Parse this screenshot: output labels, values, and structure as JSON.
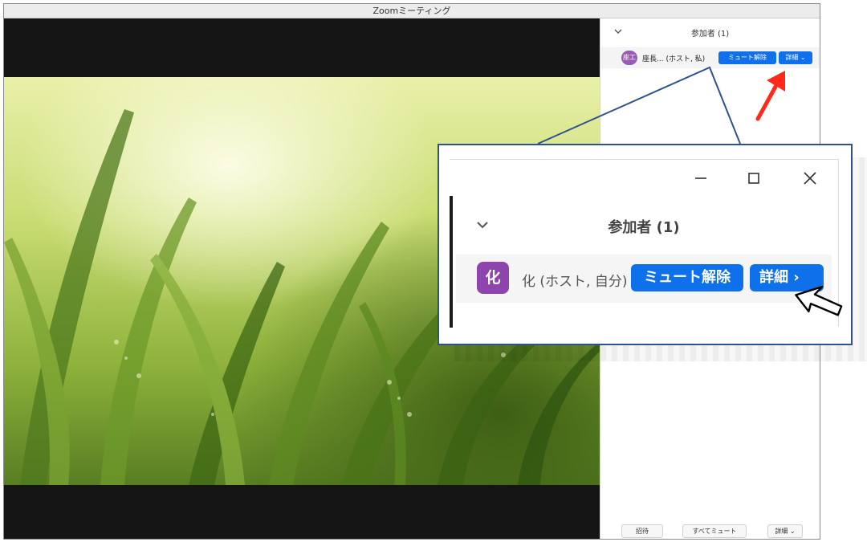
{
  "window": {
    "title": "Zoomミーティング"
  },
  "panel": {
    "title": "参加者 (1)",
    "participant": {
      "avatar_text": "座工",
      "name": "座長... (ホスト, 私)",
      "mute_label": "ミュート解除",
      "more_label": "詳細"
    },
    "footer": {
      "invite_label": "招待",
      "mute_all_label": "すべてミュート",
      "more_label": "詳細"
    }
  },
  "callout": {
    "title": "参加者 (1)",
    "participant": {
      "avatar_text": "化",
      "name": "化 (ホスト, 自分)",
      "mute_label": "ミュート解除",
      "more_label": "詳細"
    }
  },
  "colors": {
    "button_blue": "#0e71eb",
    "avatar_purple": "#8e44ad",
    "callout_border": "#2f528f",
    "arrow_red": "#ff2a1a"
  }
}
